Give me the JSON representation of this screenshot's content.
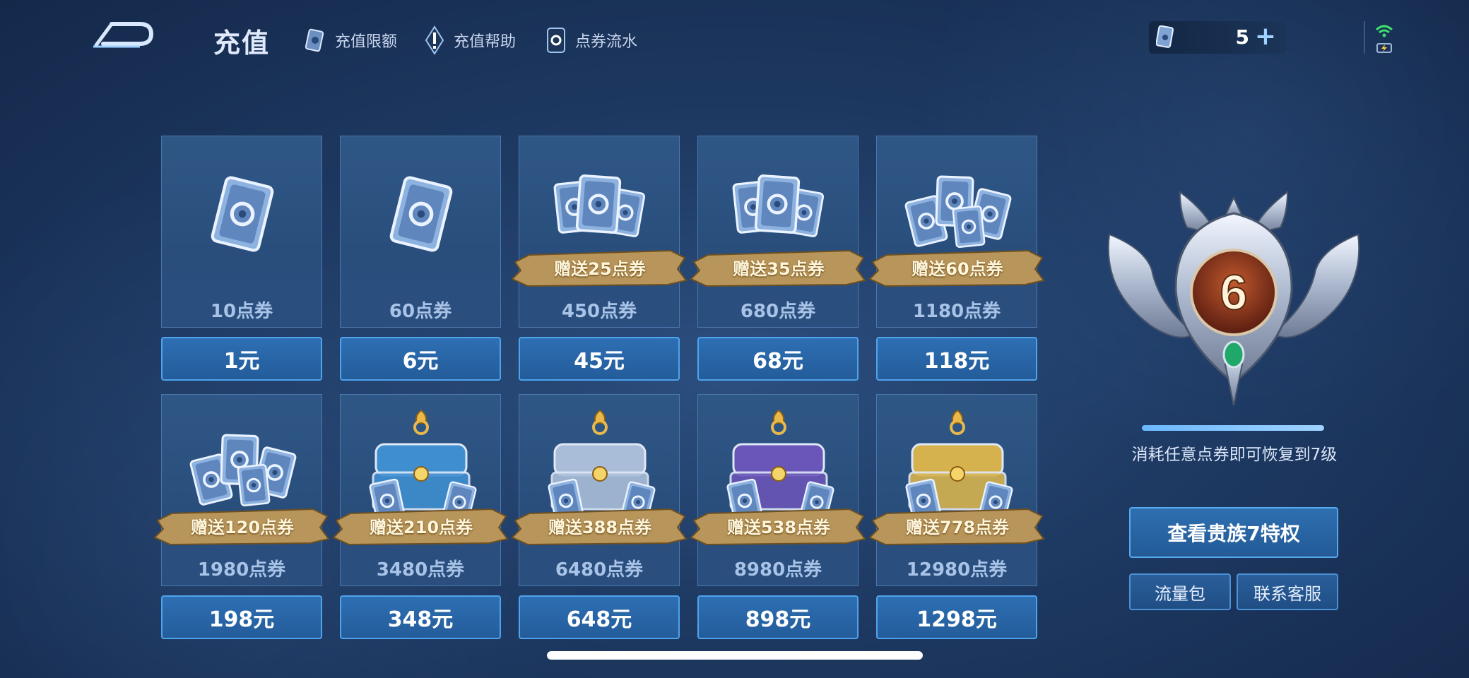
{
  "header": {
    "title": "充值",
    "nav": [
      {
        "label": "充值限额",
        "icon": "card-icon"
      },
      {
        "label": "充值帮助",
        "icon": "exclamation-icon"
      },
      {
        "label": "点券流水",
        "icon": "coupon-flow-icon"
      }
    ],
    "balance": {
      "value": "5",
      "plus": "+"
    }
  },
  "products": [
    {
      "qty": "10点券",
      "price": "1元",
      "bonus": "",
      "art": "single-card"
    },
    {
      "qty": "60点券",
      "price": "6元",
      "bonus": "",
      "art": "single-card"
    },
    {
      "qty": "450点券",
      "price": "45元",
      "bonus": "赠送25点券",
      "art": "card-stack"
    },
    {
      "qty": "680点券",
      "price": "68元",
      "bonus": "赠送35点券",
      "art": "card-stack"
    },
    {
      "qty": "1180点券",
      "price": "118元",
      "bonus": "赠送60点券",
      "art": "card-pile"
    },
    {
      "qty": "1980点券",
      "price": "198元",
      "bonus": "赠送120点券",
      "art": "card-pile"
    },
    {
      "qty": "3480点券",
      "price": "348元",
      "bonus": "赠送210点券",
      "art": "chest"
    },
    {
      "qty": "6480点券",
      "price": "648元",
      "bonus": "赠送388点券",
      "art": "chest"
    },
    {
      "qty": "8980点券",
      "price": "898元",
      "bonus": "赠送538点券",
      "art": "chest"
    },
    {
      "qty": "12980点券",
      "price": "1298元",
      "bonus": "赠送778点券",
      "art": "chest"
    }
  ],
  "vip": {
    "level": "6",
    "progress": 1.0,
    "restore_text": "消耗任意点券即可恢复到7级",
    "view_button": "查看贵族7特权",
    "traffic_button": "流量包",
    "service_button": "联系客服"
  },
  "colors": {
    "accent": "#4fa3ec",
    "ribbon": "#b8955a",
    "badge_core": "#8a3a22",
    "gem": "#1fa86a"
  }
}
